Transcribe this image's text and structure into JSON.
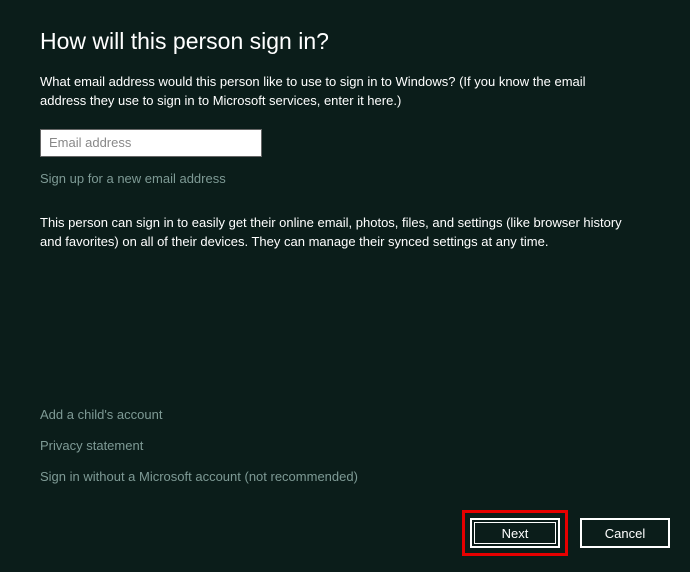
{
  "header": {
    "title": "How will this person sign in?",
    "description": "What email address would this person like to use to sign in to Windows? (If you know the email address they use to sign in to Microsoft services, enter it here.)"
  },
  "form": {
    "email_value": "",
    "email_placeholder": "Email address",
    "signup_link": "Sign up for a new email address"
  },
  "info_text": "This person can sign in to easily get their online email, photos, files, and settings (like browser history and favorites) on all of their devices. They can manage their synced settings at any time.",
  "bottom_links": {
    "add_child": "Add a child's account",
    "privacy": "Privacy statement",
    "local_signin": "Sign in without a Microsoft account (not recommended)"
  },
  "buttons": {
    "next": "Next",
    "cancel": "Cancel"
  }
}
